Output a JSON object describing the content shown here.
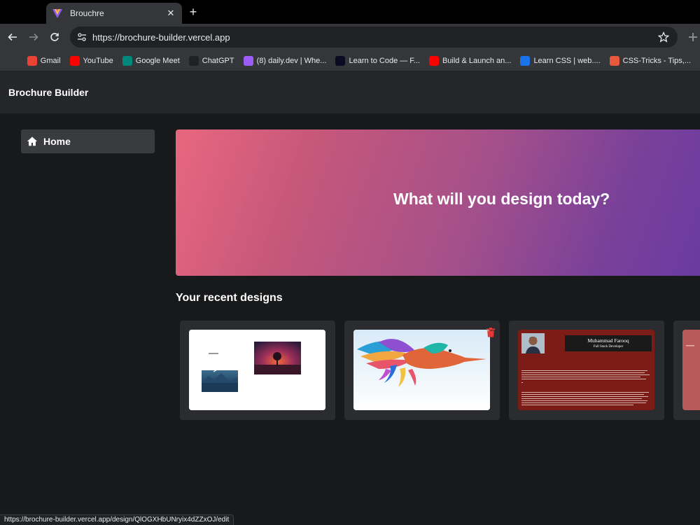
{
  "browser": {
    "tab_title": "Brouchre",
    "url": "https://brochure-builder.vercel.app",
    "status_url": "https://brochure-builder.vercel.app/design/QlOGXHbUNryix4dZZxOJ/edit",
    "bookmarks": [
      {
        "label": "Gmail",
        "icon": "gmail-icon",
        "color": "#ea4335"
      },
      {
        "label": "YouTube",
        "icon": "youtube-icon",
        "color": "#ff0000"
      },
      {
        "label": "Google Meet",
        "icon": "google-meet-icon",
        "color": "#00897b"
      },
      {
        "label": "ChatGPT",
        "icon": "chatgpt-icon",
        "color": "#202124"
      },
      {
        "label": "(8) daily.dev | Whe...",
        "icon": "dailydev-icon",
        "color": "#9c5cf6"
      },
      {
        "label": "Learn to Code — F...",
        "icon": "freecodecamp-icon",
        "color": "#0a0a23"
      },
      {
        "label": "Build & Launch an...",
        "icon": "youtube-icon",
        "color": "#ff0000"
      },
      {
        "label": "Learn CSS  |  web....",
        "icon": "webdev-icon",
        "color": "#1a73e8"
      },
      {
        "label": "CSS-Tricks - Tips,...",
        "icon": "csstricks-icon",
        "color": "#e8593c"
      }
    ]
  },
  "app": {
    "brand": "Brochure Builder",
    "sidebar": {
      "home_label": "Home"
    },
    "hero_text": "What will you design today?",
    "recent_title": "Your recent designs",
    "designs": [
      {
        "kind": "collage"
      },
      {
        "kind": "bird"
      },
      {
        "kind": "resume",
        "name": "Muhammad Farooq",
        "role": "Full Stack Developer"
      },
      {
        "kind": "red"
      }
    ],
    "colors": {
      "hero_start": "#e8677f",
      "hero_end": "#6a3aa2",
      "resume_red": "#7b1c16",
      "delete_red": "#e53935"
    }
  }
}
